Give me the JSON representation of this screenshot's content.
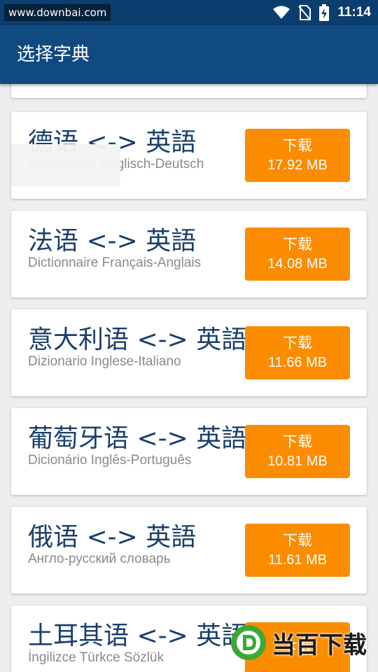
{
  "status_bar": {
    "watermark": "www.downbai.com",
    "time": "11:14"
  },
  "app_bar": {
    "title": "选择字典"
  },
  "dictionaries": [
    {
      "title": "德语 <-> 英語",
      "subtitle": "Wörterbuch Englisch-Deutsch",
      "button_label": "下载",
      "size": "17.92 MB"
    },
    {
      "title": "法语 <-> 英語",
      "subtitle": "Dictionnaire Français-Anglais",
      "button_label": "下载",
      "size": "14.08 MB"
    },
    {
      "title": "意大利语 <-> 英語",
      "subtitle": "Dizionario Inglese-Italiano",
      "button_label": "下载",
      "size": "11.66 MB"
    },
    {
      "title": "葡萄牙语 <-> 英語",
      "subtitle": "Dicionário Inglês-Português",
      "button_label": "下载",
      "size": "10.81 MB"
    },
    {
      "title": "俄语 <-> 英語",
      "subtitle": "Англо-русский словарь",
      "button_label": "下载",
      "size": "11.61 MB"
    },
    {
      "title": "土耳其语 <-> 英語",
      "subtitle": "İngilizce Türkce Sözlük",
      "button_label": "下载",
      "size": ""
    }
  ],
  "logo": {
    "text": "当百下载"
  },
  "colors": {
    "status_bar": "#0b3d6e",
    "app_bar": "#114a80",
    "button": "#fb8c00",
    "title_text": "#1a3f6b"
  }
}
